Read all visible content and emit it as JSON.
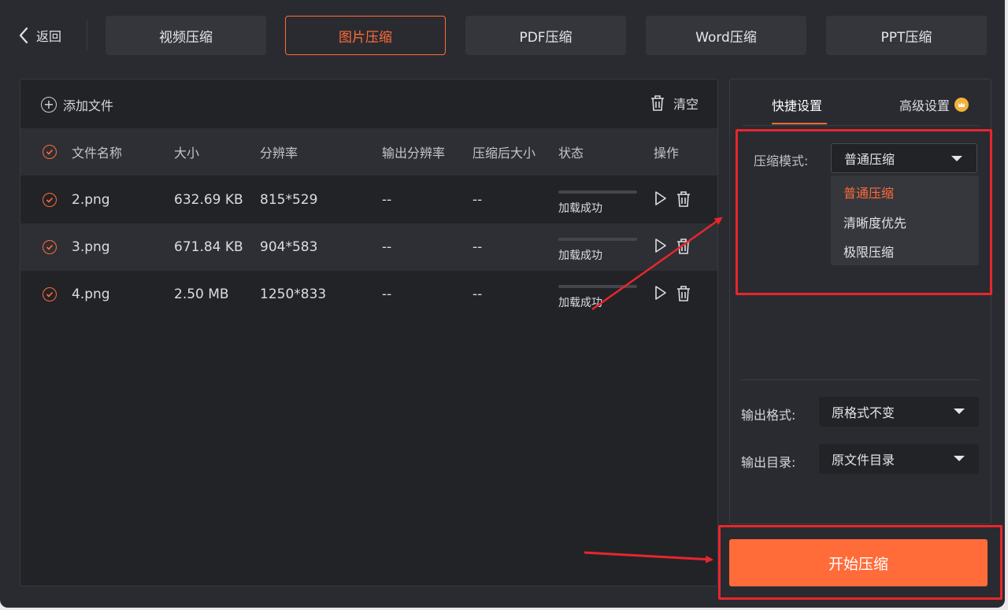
{
  "nav": {
    "back_label": "返回",
    "tabs": [
      {
        "label": "视频压缩",
        "active": false
      },
      {
        "label": "图片压缩",
        "active": true
      },
      {
        "label": "PDF压缩",
        "active": false
      },
      {
        "label": "Word压缩",
        "active": false
      },
      {
        "label": "PPT压缩",
        "active": false
      }
    ]
  },
  "file_panel": {
    "add_file_label": "添加文件",
    "clear_label": "清空",
    "columns": [
      "文件名称",
      "大小",
      "分辨率",
      "输出分辨率",
      "压缩后大小",
      "状态",
      "操作"
    ],
    "rows": [
      {
        "name": "2.png",
        "size": "632.69 KB",
        "resolution": "815*529",
        "output_resolution": "--",
        "compressed_size": "--",
        "status": "加载成功",
        "progress": 0
      },
      {
        "name": "3.png",
        "size": "671.84 KB",
        "resolution": "904*583",
        "output_resolution": "--",
        "compressed_size": "--",
        "status": "加载成功",
        "progress": 0
      },
      {
        "name": "4.png",
        "size": "2.50 MB",
        "resolution": "1250*833",
        "output_resolution": "--",
        "compressed_size": "--",
        "status": "加载成功",
        "progress": 0
      }
    ]
  },
  "settings": {
    "tab_quick": "快捷设置",
    "tab_advanced": "高级设置",
    "mode_label": "压缩模式:",
    "mode_value": "普通压缩",
    "mode_options": [
      "普通压缩",
      "清晰度优先",
      "极限压缩"
    ],
    "format_label": "输出格式:",
    "format_value": "原格式不变",
    "dir_label": "输出目录:",
    "dir_value": "原文件目录"
  },
  "start_button_label": "开始压缩",
  "colors": {
    "accent": "#ff6b39",
    "annotation_red": "#e8262d",
    "background": "#2a2b30"
  }
}
